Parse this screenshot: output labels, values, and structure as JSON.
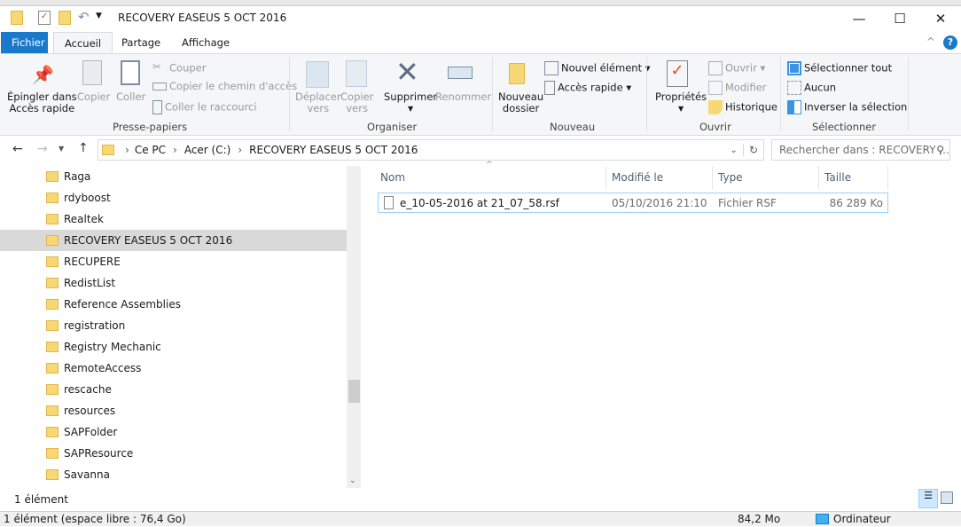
{
  "window": {
    "title": "RECOVERY EASEUS 5 OCT 2016",
    "minimize": "—",
    "maximize": "☐",
    "close": "✕"
  },
  "tabs": [
    "Fichier",
    "Accueil",
    "Partage",
    "Affichage"
  ],
  "ribbon": {
    "clipboard": {
      "pin": "Épingler dans",
      "pin2": "Accès rapide",
      "copy": "Copier",
      "paste": "Coller",
      "cut": "Couper",
      "copy_path": "Copier le chemin d'accès",
      "paste_shortcut": "Coller le raccourci",
      "label": "Presse-papiers"
    },
    "organize": {
      "move": "Déplacer",
      "move2": "vers",
      "copyto": "Copier",
      "copyto2": "vers",
      "delete": "Supprimer",
      "rename": "Renommer",
      "label": "Organiser"
    },
    "new": {
      "folder": "Nouveau",
      "folder2": "dossier",
      "item": "Nouvel élément",
      "easy": "Accès rapide",
      "label": "Nouveau"
    },
    "open": {
      "props": "Propriétés",
      "open": "Ouvrir",
      "edit": "Modifier",
      "history": "Historique",
      "label": "Ouvrir"
    },
    "select": {
      "all": "Sélectionner tout",
      "none": "Aucun",
      "invert": "Inverser la sélection",
      "label": "Sélectionner"
    }
  },
  "address": {
    "crumbs": [
      "Ce PC",
      "Acer (C:)",
      "RECOVERY EASEUS 5 OCT 2016"
    ],
    "search_placeholder": "Rechercher dans : RECOVERY ..."
  },
  "nav": [
    "Raga",
    "rdyboost",
    "Realtek",
    "RECOVERY EASEUS 5 OCT 2016",
    "RECUPERE",
    "RedistList",
    "Reference Assemblies",
    "registration",
    "Registry Mechanic",
    "RemoteAccess",
    "rescache",
    "resources",
    "SAPFolder",
    "SAPResource",
    "Savanna"
  ],
  "columns": {
    "name": "Nom",
    "modified": "Modifié le",
    "type": "Type",
    "size": "Taille"
  },
  "files": [
    {
      "name": "e_10-05-2016 at 21_07_58.rsf",
      "modified": "05/10/2016 21:10",
      "type": "Fichier RSF",
      "size": "86 289 Ko"
    }
  ],
  "status": {
    "count": "1 élément",
    "bottom": "1 élément (espace libre : 76,4 Go)",
    "size": "84,2 Mo",
    "location": "Ordinateur"
  }
}
